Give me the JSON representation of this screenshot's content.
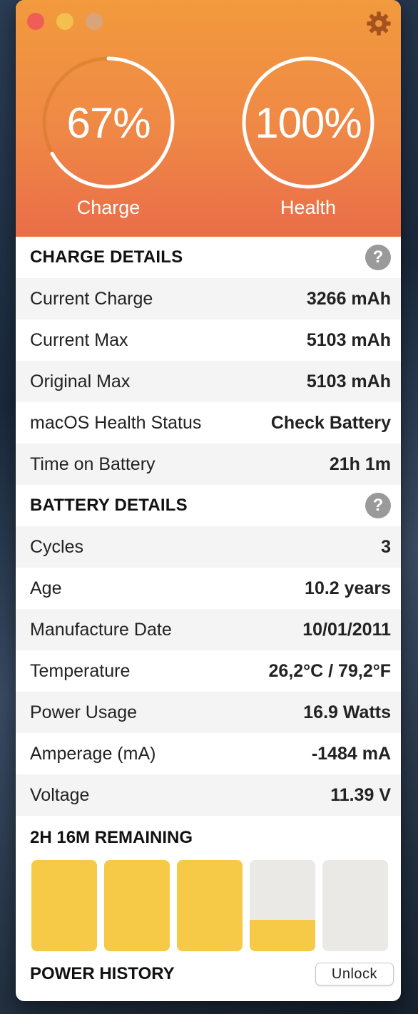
{
  "header": {
    "charge": {
      "value_text": "67%",
      "label": "Charge",
      "level": 0.67
    },
    "health": {
      "value_text": "100%",
      "label": "Health",
      "level": 1.0
    }
  },
  "charge_details": {
    "title": "CHARGE DETAILS",
    "help": "?",
    "rows": [
      {
        "label": "Current Charge",
        "value": "3266 mAh"
      },
      {
        "label": "Current Max",
        "value": "5103 mAh"
      },
      {
        "label": "Original Max",
        "value": "5103 mAh"
      },
      {
        "label": "macOS Health Status",
        "value": "Check Battery"
      },
      {
        "label": "Time on Battery",
        "value": "21h 1m"
      }
    ]
  },
  "battery_details": {
    "title": "BATTERY DETAILS",
    "help": "?",
    "rows": [
      {
        "label": "Cycles",
        "value": "3"
      },
      {
        "label": "Age",
        "value": "10.2 years"
      },
      {
        "label": "Manufacture Date",
        "value": "10/01/2011"
      },
      {
        "label": "Temperature",
        "value": "26,2°C / 79,2°F"
      },
      {
        "label": "Power Usage",
        "value": "16.9 Watts"
      },
      {
        "label": "Amperage (mA)",
        "value": "-1484 mA"
      },
      {
        "label": "Voltage",
        "value": "11.39 V"
      }
    ]
  },
  "remaining": {
    "title": "2H 16M REMAINING",
    "bar_levels": [
      1.0,
      1.0,
      1.0,
      0.34,
      0.0
    ]
  },
  "footer": {
    "title": "POWER HISTORY",
    "unlock_label": "Unlock"
  },
  "colors": {
    "header_top": "#f29a3d",
    "header_bottom": "#ea6d48",
    "bar_fill": "#f6ca46",
    "bar_empty": "#ebe9e6",
    "gear": "#a5521e"
  },
  "icons": {
    "settings": "gear-icon",
    "help": "help-icon"
  }
}
